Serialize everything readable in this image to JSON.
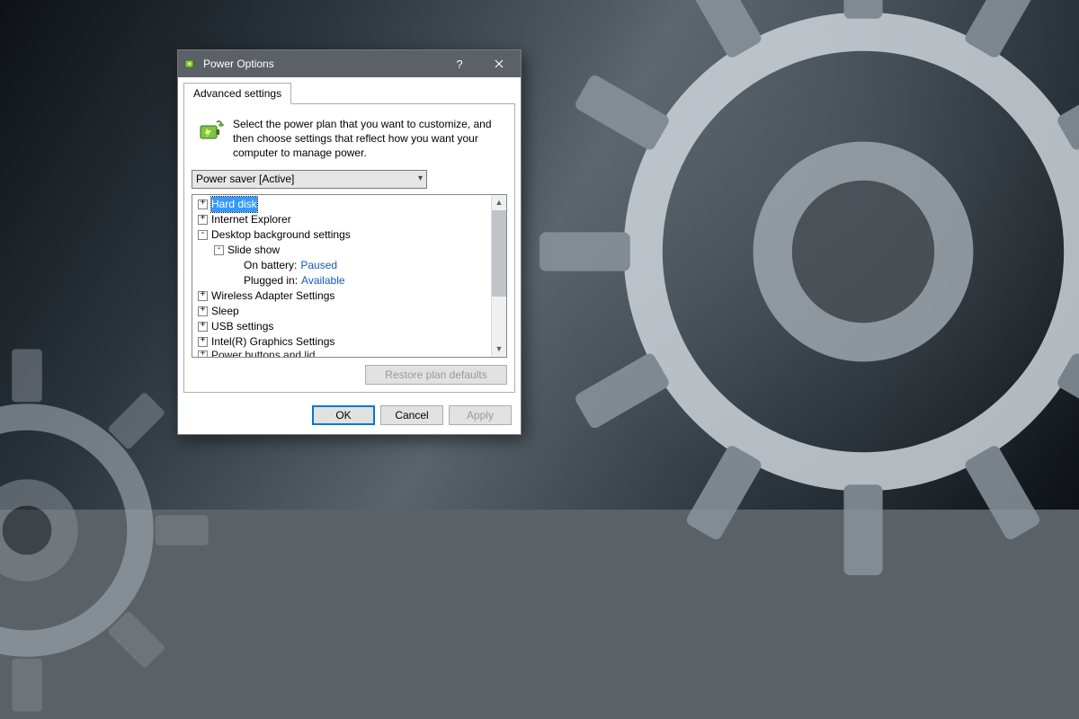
{
  "dialog": {
    "title": "Power Options",
    "tab_label": "Advanced settings",
    "intro": "Select the power plan that you want to customize, and then choose settings that reflect how you want your computer to manage power.",
    "plan_selected": "Power saver [Active]",
    "tree": {
      "hard_disk": "Hard disk",
      "ie": "Internet Explorer",
      "desktop_bg": "Desktop background settings",
      "slide_show": "Slide show",
      "on_battery_label": "On battery:",
      "on_battery_value": "Paused",
      "plugged_in_label": "Plugged in:",
      "plugged_in_value": "Available",
      "wireless": "Wireless Adapter Settings",
      "sleep": "Sleep",
      "usb": "USB settings",
      "intel_gfx": "Intel(R) Graphics Settings",
      "power_buttons": "Power buttons and lid"
    },
    "restore_defaults": "Restore plan defaults",
    "ok": "OK",
    "cancel": "Cancel",
    "apply": "Apply"
  }
}
